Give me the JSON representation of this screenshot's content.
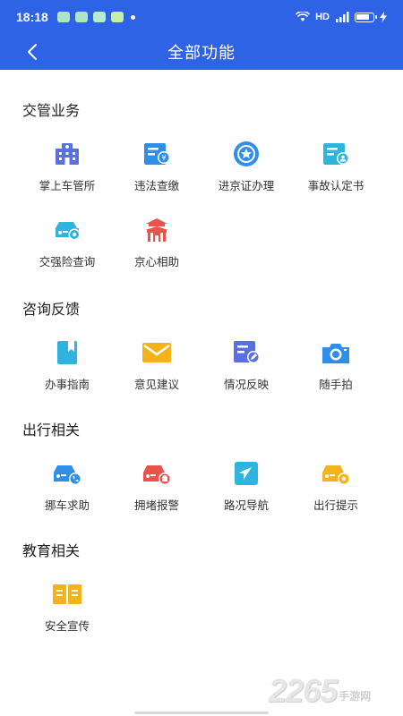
{
  "status": {
    "time": "18:18",
    "network": "HD"
  },
  "header": {
    "title": "全部功能"
  },
  "sections": [
    {
      "title": "交管业务",
      "items": [
        {
          "label": "掌上车管所",
          "icon": "police-station-icon"
        },
        {
          "label": "违法查缴",
          "icon": "fine-payment-icon"
        },
        {
          "label": "进京证办理",
          "icon": "badge-icon"
        },
        {
          "label": "事故认定书",
          "icon": "accident-report-icon"
        },
        {
          "label": "交强险查询",
          "icon": "insurance-car-icon"
        },
        {
          "label": "京心相助",
          "icon": "temple-gate-icon"
        }
      ]
    },
    {
      "title": "咨询反馈",
      "items": [
        {
          "label": "办事指南",
          "icon": "bookmark-icon"
        },
        {
          "label": "意见建议",
          "icon": "envelope-icon"
        },
        {
          "label": "情况反映",
          "icon": "edit-form-icon"
        },
        {
          "label": "随手拍",
          "icon": "camera-icon"
        }
      ]
    },
    {
      "title": "出行相关",
      "items": [
        {
          "label": "挪车求助",
          "icon": "car-phone-icon"
        },
        {
          "label": "拥堵报警",
          "icon": "car-alarm-icon"
        },
        {
          "label": "路况导航",
          "icon": "navigation-icon"
        },
        {
          "label": "出行提示",
          "icon": "car-tip-icon"
        }
      ]
    },
    {
      "title": "教育相关",
      "items": [
        {
          "label": "安全宣传",
          "icon": "open-book-icon"
        }
      ]
    }
  ],
  "watermark": {
    "number": "2265",
    "text": "手游网"
  },
  "colors": {
    "primary": "#2f63e6",
    "icon_blue": "#2f8fe8",
    "icon_red": "#e8544c",
    "icon_yellow": "#f5b31b",
    "icon_indigo": "#5870e0"
  }
}
